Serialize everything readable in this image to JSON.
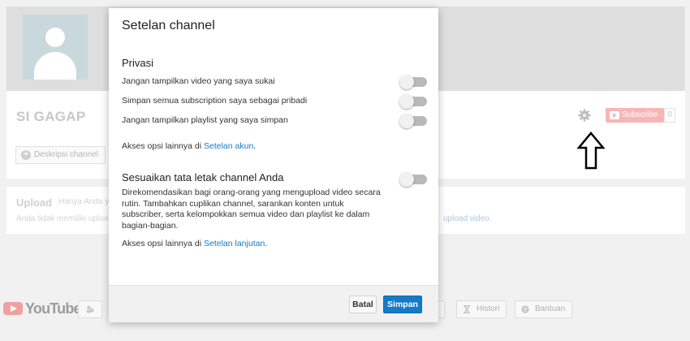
{
  "background": {
    "channel_name": "SI GAGAP",
    "about_button": "Deskripsi channel",
    "subscribe_label": "Subscribe",
    "subscriber_count": "0",
    "upload_title": "Upload",
    "upload_subtitle": "Hanya Anda yang",
    "upload_desc": "Anda tidak memiliki upload",
    "upload_link": "upload video.",
    "footer": {
      "logo_word": "YouTube",
      "history_label": "Histori",
      "help_label": "Bantuan"
    }
  },
  "modal": {
    "title": "Setelan channel",
    "privacy": {
      "title": "Privasi",
      "toggles": [
        {
          "label": "Jangan tampilkan video yang saya sukai",
          "on": false
        },
        {
          "label": "Simpan semua subscription saya sebagai pribadi",
          "on": false
        },
        {
          "label": "Jangan tampilkan playlist yang saya simpan",
          "on": false
        }
      ],
      "more_prefix": "Akses opsi lainnya di ",
      "more_link": "Setelan akun",
      "more_suffix": "."
    },
    "layout": {
      "title": "Sesuaikan tata letak channel Anda",
      "on": false,
      "description": "Direkomendasikan bagi orang-orang yang mengupload video secara rutin. Tambahkan cuplikan channel, sarankan konten untuk subscriber, serta kelompokkan semua video dan playlist ke dalam bagian-bagian.",
      "more_prefix": "Akses opsi lainnya di ",
      "more_link": "Setelan lanjutan",
      "more_suffix": "."
    },
    "cancel_label": "Batal",
    "save_label": "Simpan"
  },
  "colors": {
    "primary_blue": "#167ac6",
    "toggle_off": "#b9b9b9",
    "subscribe_red": "#f7b6b6"
  }
}
